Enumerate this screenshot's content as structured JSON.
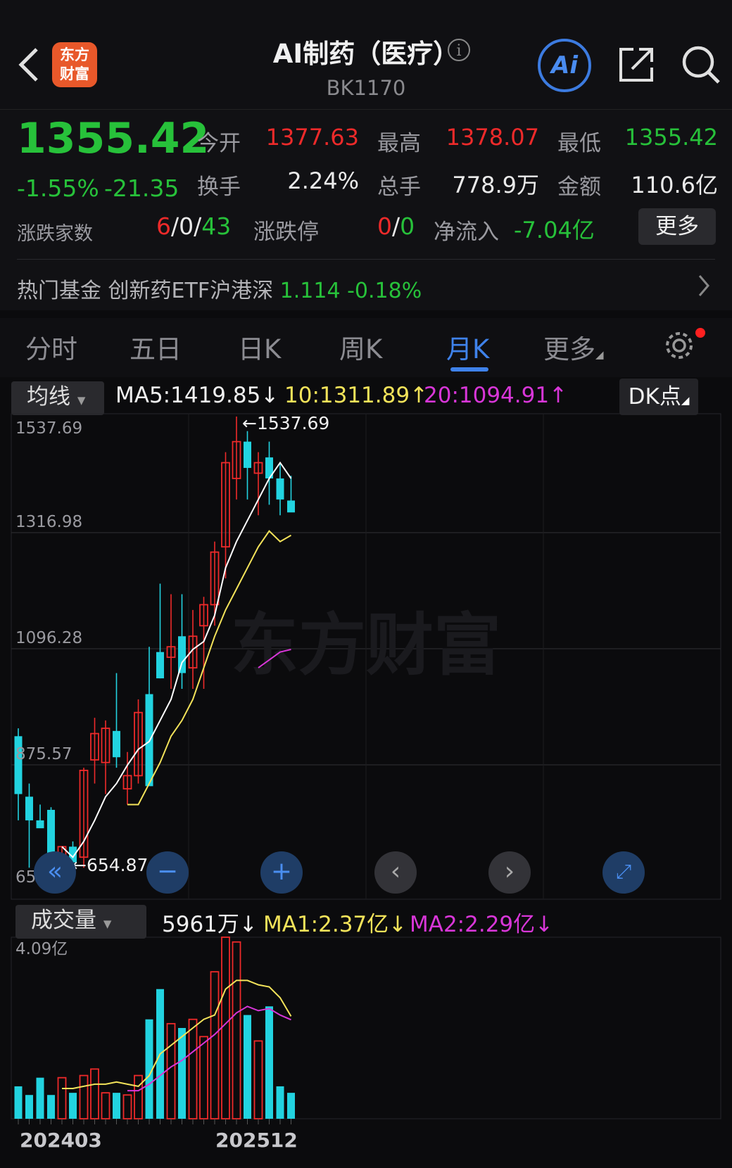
{
  "header": {
    "logo_text": "东方财富",
    "title": "AI制药（医疗）",
    "info_glyph": "i",
    "code": "BK1170",
    "ai_label": "Ai",
    "icons": [
      "back-icon",
      "info-icon",
      "share-icon",
      "search-icon"
    ]
  },
  "quote": {
    "price": "1355.42",
    "change_pct": "-1.55%",
    "change": "-21.35",
    "open_label": "今开",
    "open": "1377.63",
    "high_label": "最高",
    "high": "1378.07",
    "low_label": "最低",
    "low": "1355.42",
    "turnover_label": "换手",
    "turnover": "2.24%",
    "volume_label": "总手",
    "volume": "778.9万",
    "amount_label": "金额",
    "amount": "110.6亿",
    "breadth_label": "涨跌家数",
    "up": "6",
    "flat": "0",
    "down": "43",
    "limit_label": "涨跌停",
    "limit_up": "0",
    "limit_down": "0",
    "inflow_label": "净流入",
    "inflow": "-7.04亿",
    "more": "更多",
    "sep": "/"
  },
  "fund": {
    "label": "热门基金",
    "name": "创新药ETF沪港深",
    "nav": "1.114",
    "change": "-0.18%"
  },
  "tabs": [
    {
      "label": "分时",
      "active": false
    },
    {
      "label": "五日",
      "active": false
    },
    {
      "label": "日K",
      "active": false
    },
    {
      "label": "周K",
      "active": false
    },
    {
      "label": "月K",
      "active": true
    },
    {
      "label": "更多",
      "active": false
    }
  ],
  "indicator": {
    "select": "均线",
    "ma5": "MA5:1419.85",
    "ma10": "10:1311.89",
    "ma20": "20:1094.91",
    "ma5_arrow": "↓",
    "ma10_arrow": "↑",
    "ma20_arrow": "↑",
    "dk": "DK点"
  },
  "volume_indicator": {
    "select": "成交量",
    "vol": "5961万",
    "ma1": "MA1:2.37亿",
    "ma2": "MA2:2.29亿",
    "vol_arrow": "↓",
    "ma1_arrow": "↓",
    "ma2_arrow": "↓"
  },
  "watermark": "东方财富",
  "colors": {
    "up": "#ee2a2a",
    "down": "#27c13a",
    "candle_down": "#22d3e0",
    "ma5": "#ffffff",
    "ma10": "#f3e35a",
    "ma20": "#d836d8",
    "accent": "#3f82ea"
  },
  "chart_data": {
    "type": "candlestick",
    "yticks": [
      "1537.69",
      "1316.98",
      "1096.28",
      "875.57",
      "654.87"
    ],
    "ylim": [
      654.87,
      1537.69
    ],
    "max_label": "1537.69",
    "min_label": "654.87",
    "x_labels": [
      "202403",
      "202512"
    ],
    "candles": [
      {
        "o": 930,
        "h": 945,
        "l": 770,
        "c": 820
      },
      {
        "o": 815,
        "h": 840,
        "l": 680,
        "c": 770
      },
      {
        "o": 770,
        "h": 800,
        "l": 760,
        "c": 755
      },
      {
        "o": 790,
        "h": 795,
        "l": 680,
        "c": 700
      },
      {
        "o": 700,
        "h": 720,
        "l": 655,
        "c": 720
      },
      {
        "o": 720,
        "h": 730,
        "l": 655,
        "c": 690
      },
      {
        "o": 700,
        "h": 870,
        "l": 680,
        "c": 865
      },
      {
        "o": 885,
        "h": 965,
        "l": 840,
        "c": 935
      },
      {
        "o": 880,
        "h": 960,
        "l": 820,
        "c": 945
      },
      {
        "o": 940,
        "h": 1050,
        "l": 870,
        "c": 890
      },
      {
        "o": 830,
        "h": 900,
        "l": 800,
        "c": 855
      },
      {
        "o": 855,
        "h": 1000,
        "l": 840,
        "c": 975
      },
      {
        "o": 1010,
        "h": 1100,
        "l": 860,
        "c": 835
      },
      {
        "o": 1090,
        "h": 1220,
        "l": 1040,
        "c": 1040
      },
      {
        "o": 1080,
        "h": 1200,
        "l": 1020,
        "c": 1100
      },
      {
        "o": 1120,
        "h": 1200,
        "l": 1020,
        "c": 1050
      },
      {
        "o": 1060,
        "h": 1170,
        "l": 1020,
        "c": 1120
      },
      {
        "o": 1140,
        "h": 1195,
        "l": 1020,
        "c": 1180
      },
      {
        "o": 1180,
        "h": 1300,
        "l": 1140,
        "c": 1280
      },
      {
        "o": 1290,
        "h": 1470,
        "l": 1230,
        "c": 1450
      },
      {
        "o": 1420,
        "h": 1537.69,
        "l": 1380,
        "c": 1490
      },
      {
        "o": 1490,
        "h": 1510,
        "l": 1380,
        "c": 1440
      },
      {
        "o": 1430,
        "h": 1470,
        "l": 1350,
        "c": 1450
      },
      {
        "o": 1460,
        "h": 1490,
        "l": 1370,
        "c": 1420
      },
      {
        "o": 1420,
        "h": 1450,
        "l": 1350,
        "c": 1380
      },
      {
        "o": 1378,
        "h": 1425,
        "l": 1360,
        "c": 1355.42
      }
    ],
    "ma5": [
      null,
      null,
      null,
      null,
      720,
      700,
      730,
      770,
      815,
      840,
      875,
      905,
      920,
      960,
      1000,
      1070,
      1095,
      1110,
      1160,
      1250,
      1300,
      1340,
      1380,
      1420,
      1450,
      1420
    ],
    "ma10": [
      null,
      null,
      null,
      null,
      null,
      null,
      null,
      null,
      null,
      null,
      800,
      800,
      840,
      880,
      930,
      960,
      1000,
      1060,
      1120,
      1170,
      1210,
      1250,
      1290,
      1320,
      1300,
      1311.89
    ],
    "ma20": [
      null,
      null,
      null,
      null,
      null,
      null,
      null,
      null,
      null,
      null,
      null,
      null,
      null,
      null,
      null,
      null,
      null,
      null,
      null,
      null,
      null,
      null,
      1060,
      1075,
      1090,
      1094.91
    ],
    "volume_unit": "亿",
    "volume_max_label": "4.09亿",
    "volume": [
      0.75,
      0.55,
      0.95,
      0.55,
      0.95,
      0.6,
      1.0,
      1.15,
      0.6,
      0.6,
      0.55,
      1.0,
      2.3,
      3.0,
      2.2,
      2.1,
      2.3,
      1.9,
      3.4,
      4.2,
      4.09,
      2.4,
      1.8,
      2.6,
      0.75,
      0.6
    ],
    "volume_ma1": [
      null,
      null,
      null,
      null,
      0.7,
      0.7,
      0.75,
      0.8,
      0.8,
      0.85,
      0.8,
      0.75,
      1.0,
      1.5,
      1.7,
      1.9,
      2.1,
      2.3,
      2.4,
      3.0,
      3.2,
      3.2,
      3.1,
      3.05,
      2.8,
      2.37
    ],
    "volume_ma2": [
      null,
      null,
      null,
      null,
      null,
      null,
      null,
      null,
      null,
      null,
      0.65,
      0.65,
      0.8,
      1.0,
      1.2,
      1.35,
      1.55,
      1.75,
      1.95,
      2.2,
      2.45,
      2.6,
      2.5,
      2.55,
      2.4,
      2.29
    ]
  }
}
